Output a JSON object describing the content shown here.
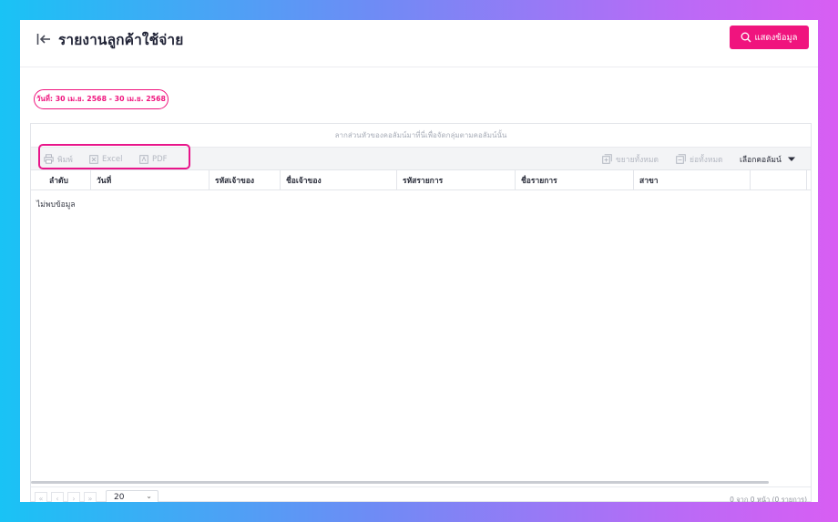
{
  "header": {
    "title": "รายงานลูกค้าใช้จ่าย",
    "show_button_label": "แสดงข้อมูล"
  },
  "filter": {
    "date_range": "วันที่: 30 เม.ย. 2568 - 30 เม.ย. 2568"
  },
  "grid": {
    "group_panel_hint": "ลากส่วนหัวของคอลัมน์มาที่นี่เพื่อจัดกลุ่มตามคอลัมน์นั้น",
    "toolbar": {
      "print": "พิมพ์",
      "excel": "Excel",
      "pdf": "PDF",
      "expand_all": "ขยายทั้งหมด",
      "collapse_all": "ย่อทั้งหมด",
      "choose_columns": "เลือกคอลัมน์"
    },
    "columns": [
      "ลำดับ",
      "วันที่",
      "รหัสเจ้าของ",
      "ชื่อเจ้าของ",
      "รหัสรายการ",
      "ชื่อรายการ",
      "สาขา"
    ],
    "empty_message": "ไม่พบข้อมูล",
    "pager": {
      "page_size": "20",
      "info": "0 จาก 0 หน้า (0 รายการ)"
    }
  },
  "colors": {
    "accent": "#f0147e",
    "highlight": "#e8158a"
  },
  "icons": {
    "back": "arrow-left-to-line-icon",
    "search": "search-icon",
    "print": "printer-icon",
    "excel": "excel-icon",
    "pdf": "pdf-icon",
    "expand": "expand-icon",
    "collapse": "collapse-icon",
    "dropdown": "caret-down-icon"
  }
}
